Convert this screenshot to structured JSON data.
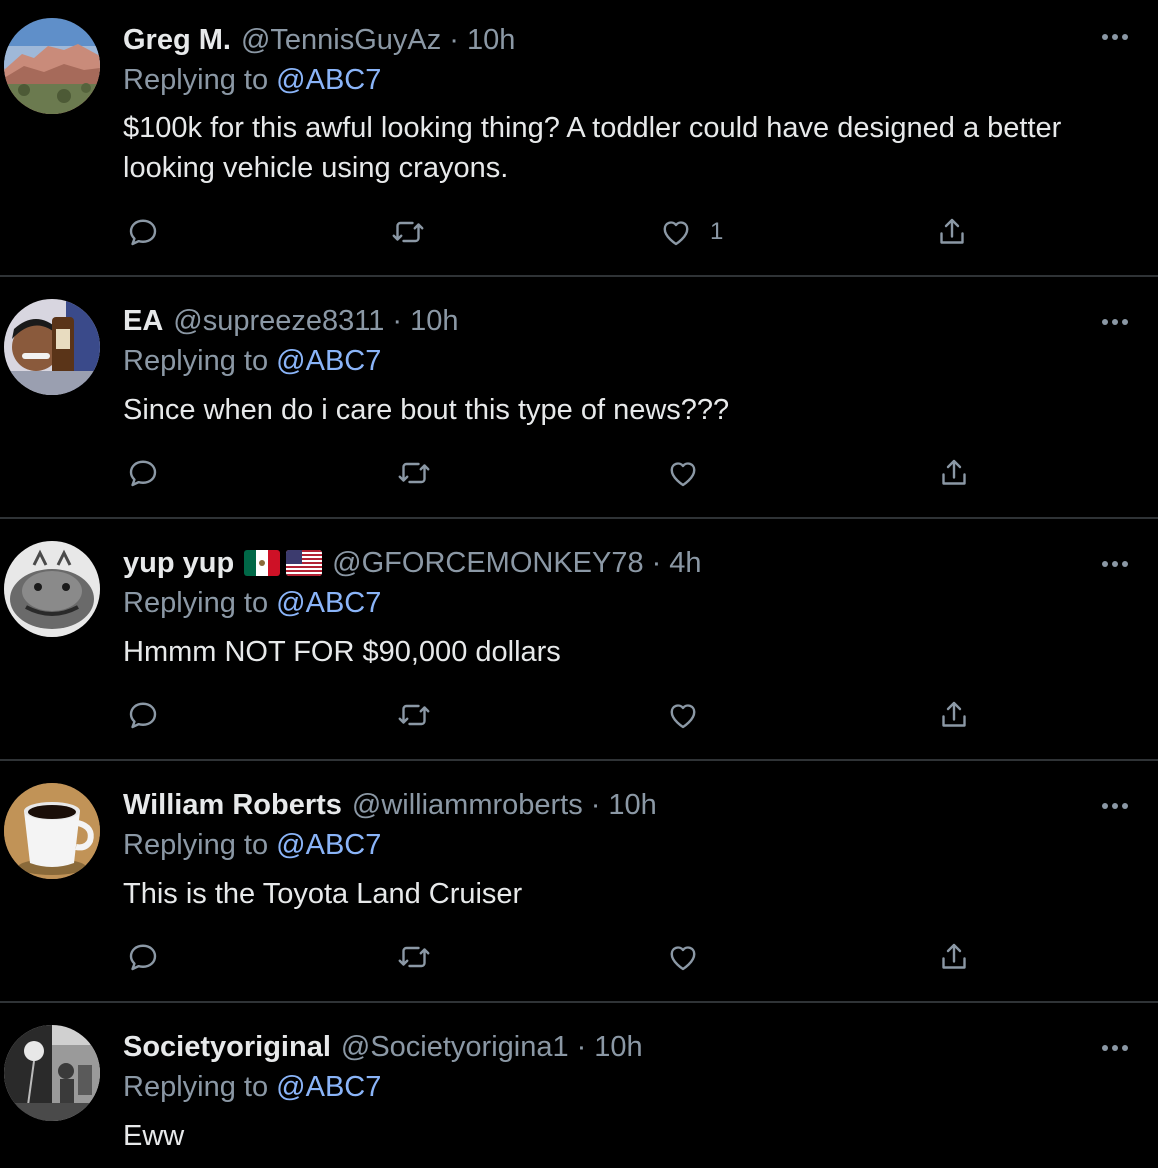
{
  "colors": {
    "background": "#000000",
    "divider": "#2f3336",
    "primary_text": "#e7e9ea",
    "secondary_text": "#8b98a5",
    "mention": "#8ab4f8"
  },
  "replies": [
    {
      "name": "Greg M.",
      "handle": "@TennisGuyAz",
      "separator": "·",
      "time": "10h",
      "replying_prefix": "Replying to ",
      "replying_to": "@ABC7",
      "text": "$100k for this awful looking thing? A toddler could have designed a better looking vehicle using crayons.",
      "like_count": "1",
      "avatar": "desert-landscape-avatar"
    },
    {
      "name": "EA",
      "handle": "@supreeze8311",
      "separator": "·",
      "time": "10h",
      "replying_prefix": "Replying to ",
      "replying_to": "@ABC7",
      "text": "Since when do i care bout this type of news???",
      "like_count": "",
      "avatar": "person-with-bottle-avatar"
    },
    {
      "name": "yup yup",
      "flags": [
        "mexico-flag",
        "usa-flag"
      ],
      "handle": "@GFORCEMONKEY78",
      "separator": "·",
      "time": "4h",
      "replying_prefix": "Replying to ",
      "replying_to": "@ABC7",
      "text": "Hmmm NOT FOR $90,000 dollars",
      "like_count": "",
      "avatar": "fish-avatar"
    },
    {
      "name": "William Roberts",
      "handle": "@williammroberts",
      "separator": "·",
      "time": "10h",
      "replying_prefix": "Replying to ",
      "replying_to": "@ABC7",
      "text": "This is the Toyota Land Cruiser",
      "like_count": "",
      "avatar": "coffee-cup-avatar"
    },
    {
      "name": "Societyoriginal",
      "handle": "@Societyorigina1",
      "separator": "·",
      "time": "10h",
      "replying_prefix": "Replying to ",
      "replying_to": "@ABC7",
      "text": "Eww",
      "like_count": "",
      "avatar": "studio-photo-avatar"
    }
  ],
  "icons": {
    "more": "more-options-icon",
    "reply": "reply-icon",
    "retweet": "retweet-icon",
    "like": "like-icon",
    "share": "share-icon"
  }
}
